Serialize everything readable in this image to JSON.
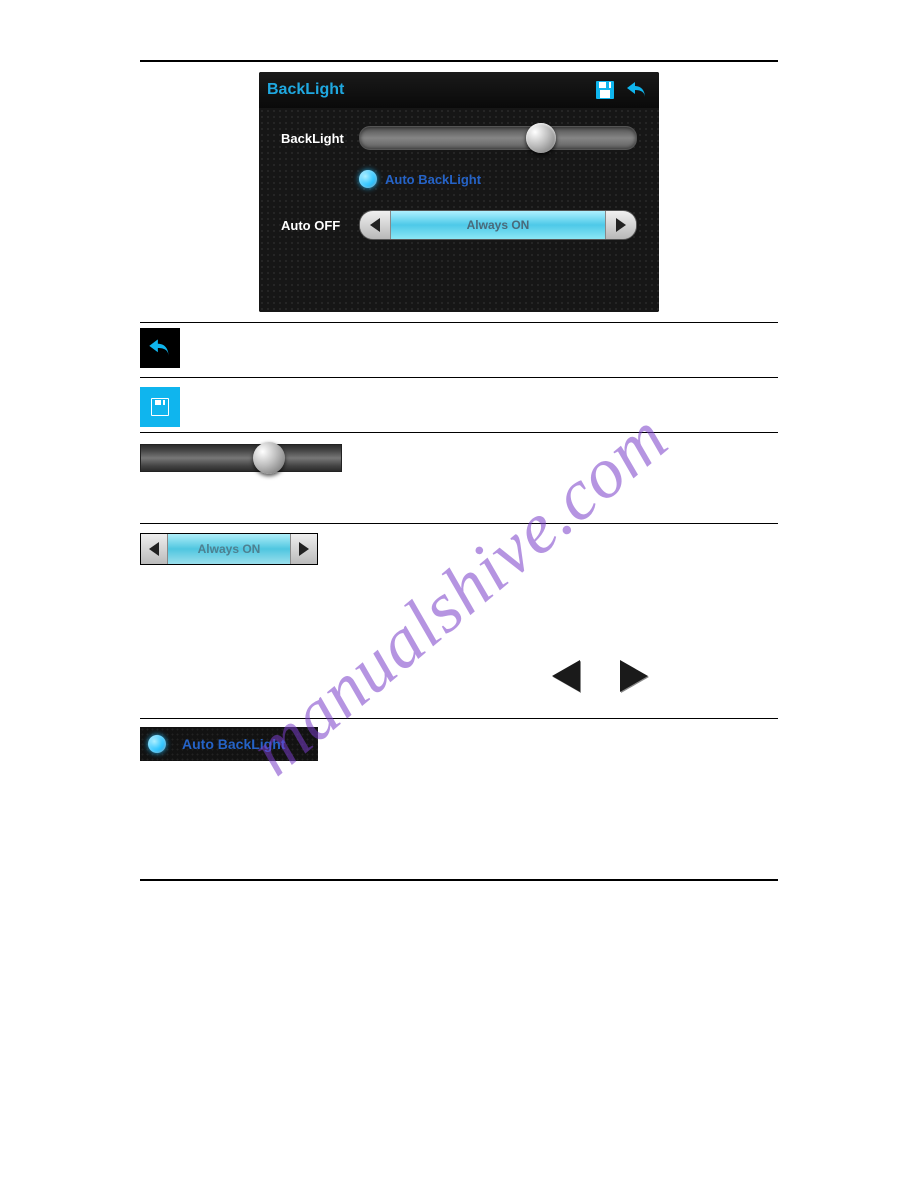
{
  "watermark": "manualshive.com",
  "screenshot": {
    "title": "BackLight",
    "rows": {
      "backlight_label": "BackLight",
      "auto_backlight_label": "Auto BackLight",
      "auto_off_label": "Auto OFF",
      "auto_off_value": "Always ON"
    }
  },
  "legend": {
    "always_on": "Always ON",
    "auto_backlight": "Auto BackLight"
  }
}
